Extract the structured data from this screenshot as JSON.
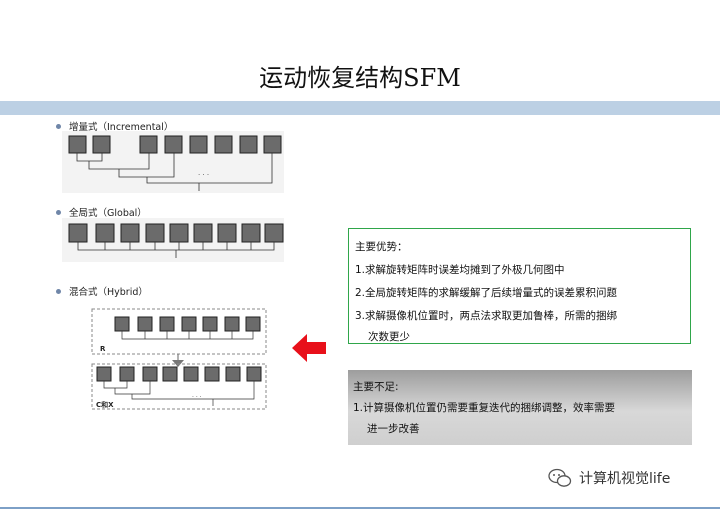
{
  "slide": {
    "title": "运动恢复结构SFM"
  },
  "sections": {
    "incremental": {
      "label": "增量式（Incremental）"
    },
    "global": {
      "label": "全局式（Global）"
    },
    "hybrid": {
      "label": "混合式（Hybrid）",
      "r_label": "R",
      "c_label": "C和X"
    }
  },
  "advantages": {
    "heading": "主要优势：",
    "items": [
      "1.求解旋转矩阵时误差均摊到了外极几何图中",
      "2.全局旋转矩阵的求解缓解了后续增量式的误差累积问题",
      "3.求解摄像机位置时，两点法求取更加鲁棒，所需的捆绑",
      "次数更少"
    ]
  },
  "disadvantages": {
    "heading": "主要不足:",
    "items": [
      "1.计算摄像机位置仍需要重复迭代的捆绑调整，效率需要",
      "进一步改善"
    ]
  },
  "footer": {
    "watermark": "计算机视觉life"
  },
  "colors": {
    "accent_band": "#bcd0e4",
    "advantage_border": "#2fa64a",
    "arrow": "#e8101a"
  }
}
